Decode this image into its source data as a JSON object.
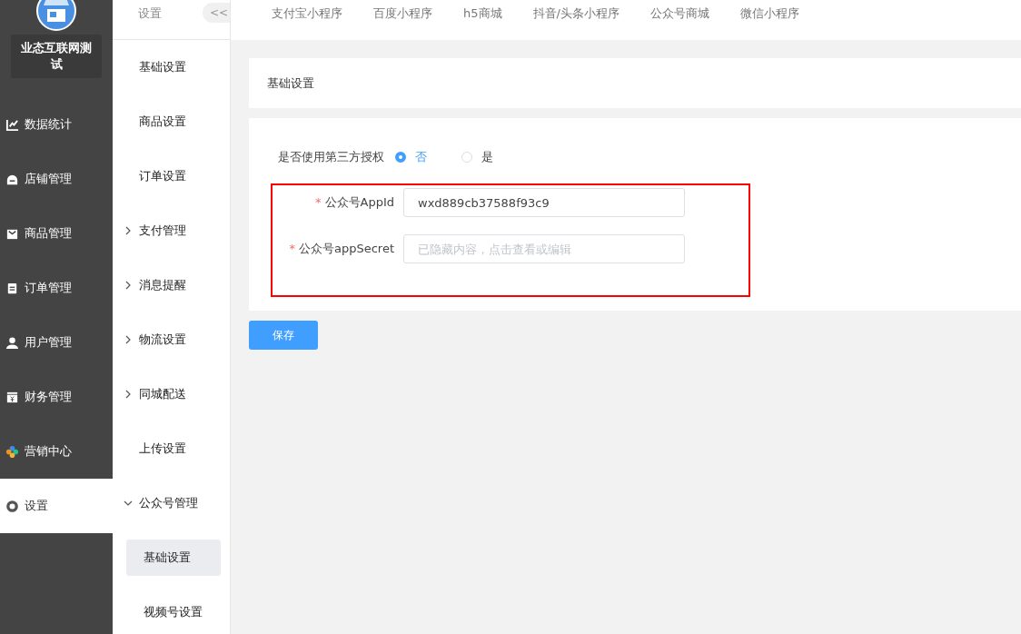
{
  "store": {
    "name": "业态互联网测试"
  },
  "main_menu": [
    {
      "label": "数据统计",
      "selected": false
    },
    {
      "label": "店铺管理",
      "selected": false
    },
    {
      "label": "商品管理",
      "selected": false
    },
    {
      "label": "订单管理",
      "selected": false
    },
    {
      "label": "用户管理",
      "selected": false
    },
    {
      "label": "财务管理",
      "selected": false
    },
    {
      "label": "营销中心",
      "selected": false
    },
    {
      "label": "设置",
      "selected": true
    }
  ],
  "submenu": {
    "title": "设置",
    "collapse_button": "<<",
    "items": [
      {
        "kind": "link",
        "label": "基础设置"
      },
      {
        "kind": "link",
        "label": "商品设置"
      },
      {
        "kind": "link",
        "label": "订单设置"
      },
      {
        "kind": "group",
        "label": "支付管理",
        "expanded": false
      },
      {
        "kind": "group",
        "label": "消息提醒",
        "expanded": false
      },
      {
        "kind": "group",
        "label": "物流设置",
        "expanded": false
      },
      {
        "kind": "group",
        "label": "同城配送",
        "expanded": false
      },
      {
        "kind": "link",
        "label": "上传设置"
      },
      {
        "kind": "group",
        "label": "公众号管理",
        "expanded": true,
        "children": [
          {
            "label": "基础设置",
            "selected": true
          },
          {
            "label": "视频号设置",
            "selected": false
          }
        ]
      }
    ]
  },
  "tabs": [
    {
      "label": "支付宝小程序"
    },
    {
      "label": "百度小程序"
    },
    {
      "label": "h5商城"
    },
    {
      "label": "抖音/头条小程序"
    },
    {
      "label": "公众号商城"
    },
    {
      "label": "微信小程序"
    }
  ],
  "page_title": "基础设置",
  "form": {
    "auth": {
      "label": "是否使用第三方授权",
      "options": [
        {
          "label": "否",
          "selected": true
        },
        {
          "label": "是",
          "selected": false
        }
      ]
    },
    "fields": [
      {
        "label": "公众号AppId",
        "required_mark": "*",
        "value": "wxd889cb37588f93c9"
      },
      {
        "label": "公众号appSecret",
        "required_mark": "*",
        "placeholder": "已隐藏内容，点击查看或编辑"
      }
    ],
    "save_button": "保存"
  }
}
